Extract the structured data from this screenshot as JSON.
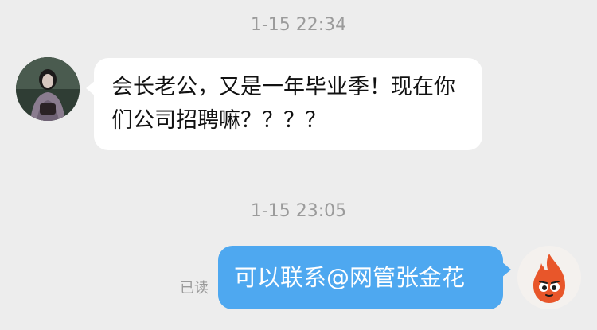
{
  "messages": [
    {
      "timestamp": "1-15 22:34",
      "sender": "other",
      "avatar_icon": "woman-photo-avatar-icon",
      "text": "会长老公，又是一年毕业季！现在你们公司招聘嘛？？？？"
    },
    {
      "timestamp": "1-15 23:05",
      "sender": "self",
      "avatar_icon": "fire-mascot-avatar-icon",
      "text": "可以联系@网管张金花",
      "status": "已读"
    }
  ],
  "colors": {
    "background": "#ededed",
    "incoming_bubble": "#ffffff",
    "outgoing_bubble": "#4ea8f0",
    "timestamp_text": "#9b9b9b"
  }
}
